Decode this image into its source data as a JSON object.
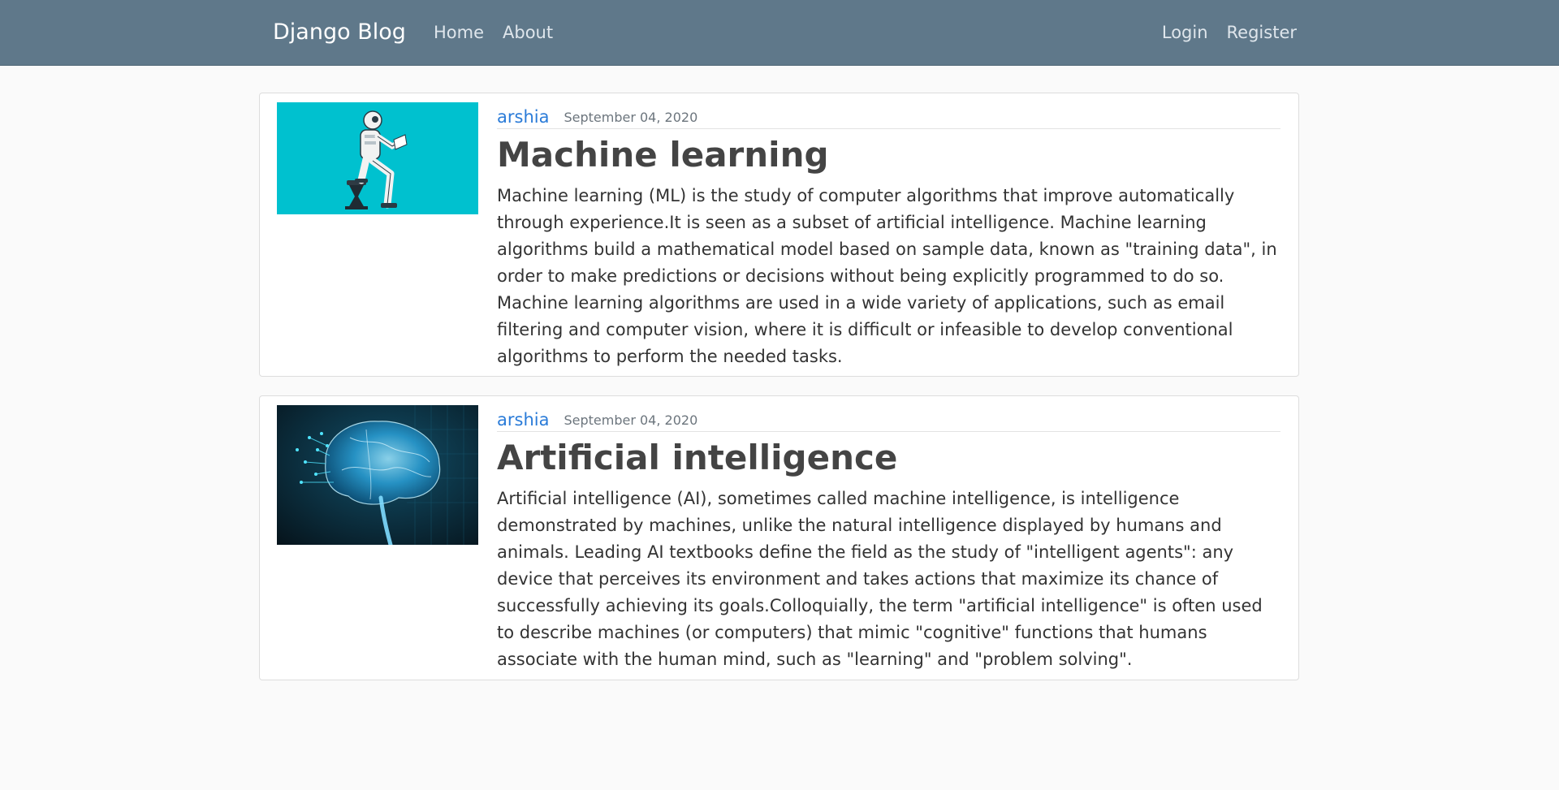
{
  "navbar": {
    "brand": "Django Blog",
    "left_links": [
      "Home",
      "About"
    ],
    "right_links": [
      "Login",
      "Register"
    ],
    "background": "#5f788a"
  },
  "posts": [
    {
      "author": "arshia",
      "date": "September 04, 2020",
      "title": "Machine learning",
      "content": "Machine learning (ML) is the study of computer algorithms that improve automatically through experience.It is seen as a subset of artificial intelligence. Machine learning algorithms build a mathematical model based on sample data, known as \"training data\", in order to make predictions or decisions without being explicitly programmed to do so. Machine learning algorithms are used in a wide variety of applications, such as email filtering and computer vision, where it is difficult or infeasible to develop conventional algorithms to perform the needed tasks.",
      "image": "robot-reading-book-icon",
      "image_color": "#00c1cf"
    },
    {
      "author": "arshia",
      "date": "September 04, 2020",
      "title": "Artificial intelligence",
      "content": "Artificial intelligence (AI), sometimes called machine intelligence, is intelligence demonstrated by machines, unlike the natural intelligence displayed by humans and animals. Leading AI textbooks define the field as the study of \"intelligent agents\": any device that perceives its environment and takes actions that maximize its chance of successfully achieving its goals.Colloquially, the term \"artificial intelligence\" is often used to describe machines (or computers) that mimic \"cognitive\" functions that humans associate with the human mind, such as \"learning\" and \"problem solving\".",
      "image": "digital-brain-icon",
      "image_color": "#0a2230"
    }
  ],
  "colors": {
    "link": "#2a7bd8",
    "page_background": "#fafafa"
  }
}
